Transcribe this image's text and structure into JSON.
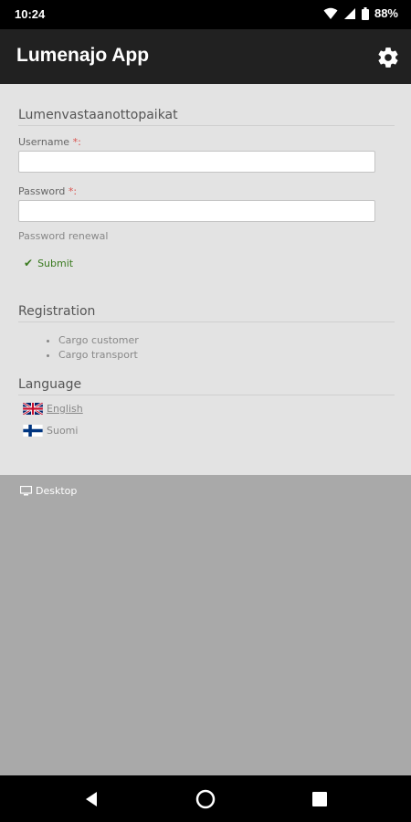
{
  "status_bar": {
    "time": "10:24",
    "battery": "88%"
  },
  "app_bar": {
    "title": "Lumenajo App",
    "settings_icon": "gear-icon"
  },
  "login": {
    "section_title": "Lumenvastaanottopaikat",
    "username_label": "Username",
    "password_label": "Password",
    "required_mark": "*:",
    "username_value": "",
    "password_value": "",
    "password_renewal": "Password renewal",
    "submit_label": "Submit"
  },
  "registration": {
    "title": "Registration",
    "items": [
      "Cargo customer",
      "Cargo transport"
    ]
  },
  "language": {
    "title": "Language",
    "options": [
      {
        "label": "English",
        "flag": "uk-flag-icon",
        "selected": true
      },
      {
        "label": "Suomi",
        "flag": "finland-flag-icon",
        "selected": false
      }
    ]
  },
  "footer": {
    "desktop_label": "Desktop",
    "desktop_icon": "monitor-icon"
  },
  "colors": {
    "app_bar": "#212121",
    "content_bg": "#e3e3e3",
    "page_bg": "#a9a9a9",
    "submit_green": "#3a7a1f",
    "required_red": "#d9534f"
  }
}
